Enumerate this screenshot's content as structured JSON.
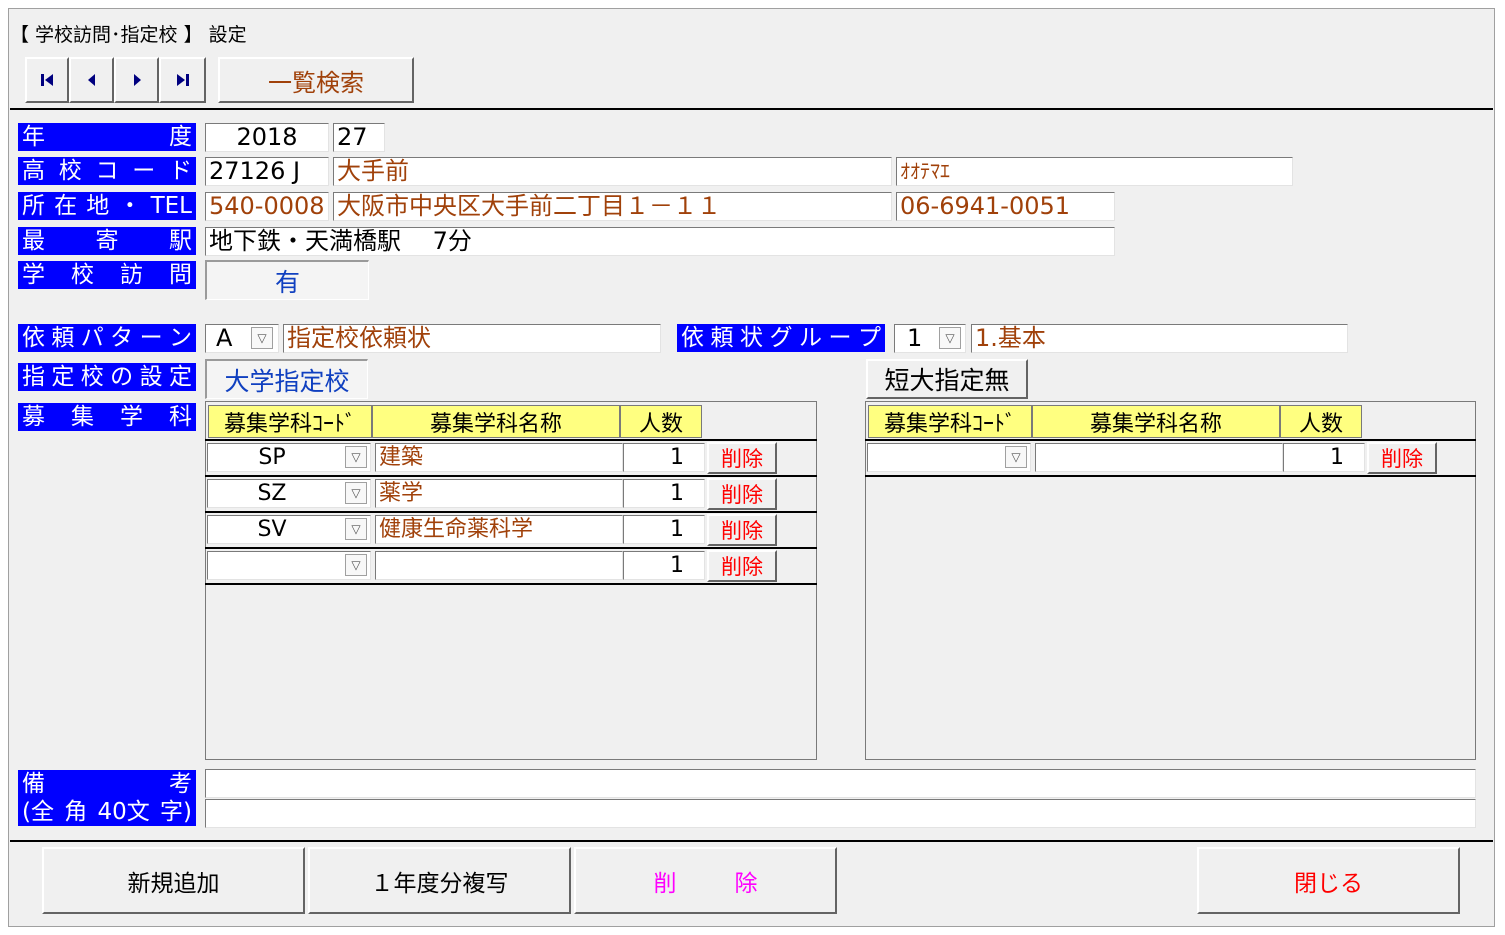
{
  "window": {
    "title": "【 学校訪問･指定校 】 設定"
  },
  "nav": {
    "first": "⏮",
    "prev": "◀",
    "next": "▶",
    "last": "⏭",
    "search_label": "一覧検索"
  },
  "labels": {
    "year": [
      "年",
      "度"
    ],
    "school_code": [
      "高",
      "校",
      "コ",
      "ー",
      "ド"
    ],
    "address": [
      "所",
      "在",
      "地",
      "・",
      "TEL"
    ],
    "station": [
      "最",
      "寄",
      "駅"
    ],
    "visit": [
      "学",
      "校",
      "訪",
      "問"
    ],
    "pattern": [
      "依",
      "頼",
      "パ",
      "タ",
      "ー",
      "ン"
    ],
    "letter_group": [
      "依",
      "頼",
      "状",
      "グ",
      "ル",
      "ー",
      "プ"
    ],
    "designation": [
      "指",
      "定",
      "校",
      "の",
      "設",
      "定"
    ],
    "department": [
      "募",
      "集",
      "学",
      "科"
    ],
    "remarks": [
      "備",
      "考"
    ],
    "remarks_note": [
      "(全",
      "角",
      "40文",
      "字)"
    ]
  },
  "fields": {
    "year": "2018",
    "year_no": "27",
    "school_code": "27126 J",
    "school_name": "大手前",
    "school_kana": "ｵｵﾃﾏｴ",
    "postal": "540-0008",
    "address": "大阪市中央区大手前二丁目１－１１",
    "tel": "06-6941-0051",
    "station": "地下鉄・天満橋駅　 7分",
    "visit": "有",
    "pattern_code": "A",
    "pattern_name": "指定校依頼状",
    "group_code": "1",
    "group_name": "1.基本",
    "remarks1": "",
    "remarks2": ""
  },
  "tabs": {
    "university": "大学指定校",
    "junior_college": "短大指定無"
  },
  "table_headers": {
    "code": "募集学科ｺｰﾄﾞ",
    "name": "募集学科名称",
    "count": "人数",
    "delete": "削除"
  },
  "university_rows": [
    {
      "code": "SP",
      "name": "建築",
      "count": "1"
    },
    {
      "code": "SZ",
      "name": "薬学",
      "count": "1"
    },
    {
      "code": "SV",
      "name": "健康生命薬科学",
      "count": "1"
    },
    {
      "code": "",
      "name": "",
      "count": "1"
    }
  ],
  "college_rows": [
    {
      "code": "",
      "name": "",
      "count": "1"
    }
  ],
  "footer": {
    "new_label": "新規追加",
    "copy_label": "１年度分複写",
    "delete_label": [
      "削",
      "除"
    ],
    "close_label": "閉じる"
  },
  "colors": {
    "label_bg": "#0000ff",
    "header_bg": "#ffff80",
    "brown_text": "#a0410a",
    "delete_red": "#ff0000",
    "delete_magenta": "#ff00ff"
  }
}
